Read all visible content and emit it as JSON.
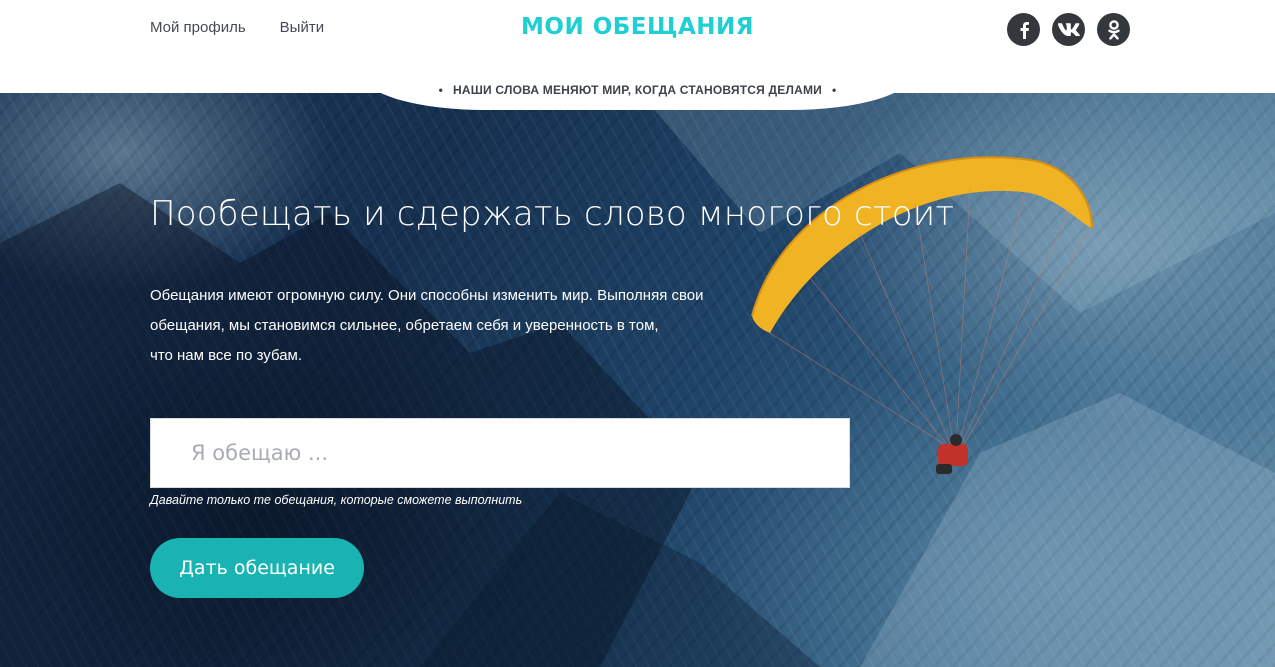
{
  "header": {
    "nav": [
      {
        "label": "Мой профиль"
      },
      {
        "label": "Выйти"
      }
    ],
    "logo": "МОИ ОБЕЩАНИЯ",
    "logo_color": "#1fcfd3",
    "socials": [
      {
        "icon": "facebook-icon"
      },
      {
        "icon": "vk-icon"
      },
      {
        "icon": "odnoklassniki-icon"
      }
    ],
    "tagline": "НАШИ СЛОВА МЕНЯЮТ МИР, КОГДА СТАНОВЯТСЯ ДЕЛАМИ",
    "tagline_bullet": "•"
  },
  "hero": {
    "headline": "Пообещать и сдержать слово многого стоит",
    "description_lines": [
      "Обещания имеют огромную силу. Они способны изменить мир. Выполняя свои",
      "обещания, мы становимся сильнее, обретаем себя и уверенность в том,",
      "что нам все по зубам."
    ],
    "promise_input": {
      "value": "",
      "placeholder": "Я обещаю ..."
    },
    "hint": "Давайте только те обещания, которые сможете выполнить",
    "submit_label": "Дать обещание",
    "accent_color": "#1ab3b3",
    "canopy_color": "#f0b323"
  }
}
